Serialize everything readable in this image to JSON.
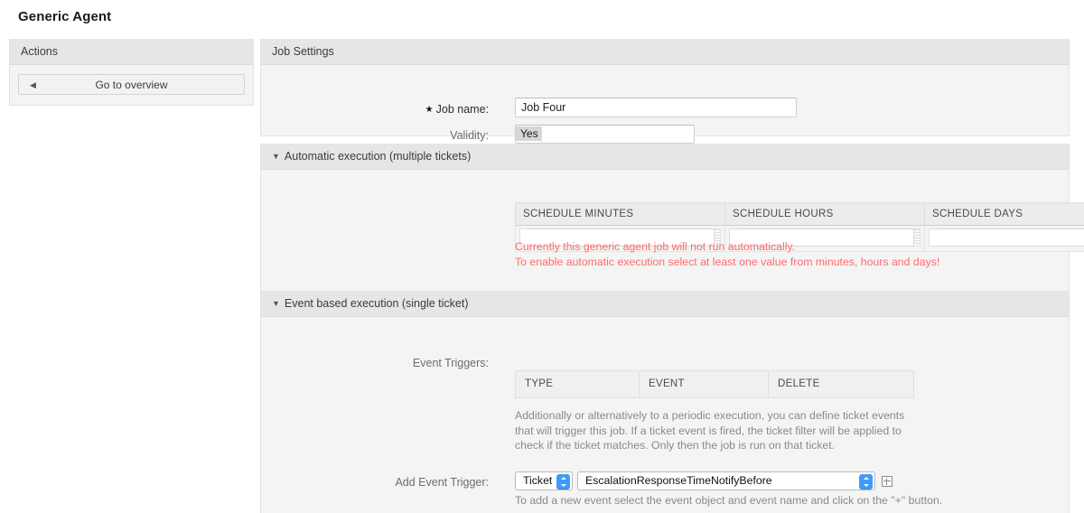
{
  "page": {
    "title": "Generic Agent"
  },
  "sidebar": {
    "header": "Actions",
    "back_icon": "◀",
    "overview_button": "Go to overview"
  },
  "job_settings": {
    "header": "Job Settings",
    "job_name_label": "Job name:",
    "required_star": "★",
    "job_name_value": "Job Four",
    "validity_label": "Validity:",
    "validity_options": [
      "Yes"
    ],
    "validity_selected": "Yes"
  },
  "auto_execution": {
    "collapse_icon": "▼",
    "header": "Automatic execution (multiple tickets)",
    "columns": [
      "SCHEDULE MINUTES",
      "SCHEDULE HOURS",
      "SCHEDULE DAYS"
    ],
    "minutes_value": "",
    "hours_value": "",
    "days_value": "",
    "warning_line1": "Currently this generic agent job will not run automatically.",
    "warning_line2": "To enable automatic execution select at least one value from minutes, hours and days!",
    "warning_color": "#ff6b6b"
  },
  "event_execution": {
    "collapse_icon": "▼",
    "header": "Event based execution (single ticket)",
    "event_triggers_label": "Event Triggers:",
    "trigger_columns": [
      "TYPE",
      "EVENT",
      "DELETE"
    ],
    "help_text": "Additionally or alternatively to a periodic execution, you can define ticket events that will trigger this job. If a ticket event is fired, the ticket filter will be applied to check if the ticket matches. Only then the job is run on that ticket.",
    "add_trigger_label": "Add Event Trigger:",
    "object_select_value": "Ticket",
    "event_select_value": "EscalationResponseTimeNotifyBefore",
    "add_icon": "plus-box-icon",
    "add_hint": "To add a new event select the event object and event name and click on the \"+\" button."
  }
}
